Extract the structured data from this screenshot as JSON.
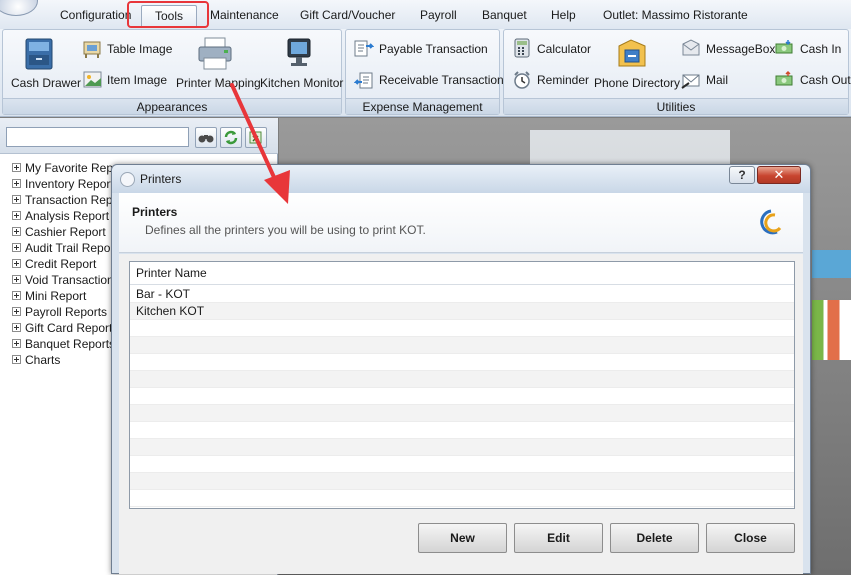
{
  "menu": {
    "items": [
      {
        "id": "configuration",
        "label": "Configuration"
      },
      {
        "id": "tools",
        "label": "Tools"
      },
      {
        "id": "maintenance",
        "label": "Maintenance"
      },
      {
        "id": "giftcard",
        "label": "Gift Card/Voucher"
      },
      {
        "id": "payroll",
        "label": "Payroll"
      },
      {
        "id": "banquet",
        "label": "Banquet"
      },
      {
        "id": "help",
        "label": "Help"
      },
      {
        "id": "outlet",
        "label": "Outlet: Massimo Ristorante"
      }
    ],
    "active": "Tools"
  },
  "ribbon": {
    "appearances": {
      "label": "Appearances",
      "cash_drawer": "Cash Drawer",
      "table_image": "Table Image",
      "item_image": "Item Image",
      "printer_mapping": "Printer Mapping",
      "kitchen_monitor": "Kitchen Monitor"
    },
    "expense": {
      "label": "Expense Management",
      "payable": "Payable Transaction",
      "receivable": "Receivable Transaction"
    },
    "utilities": {
      "label": "Utilities",
      "calculator": "Calculator",
      "reminder": "Reminder",
      "phone_directory": "Phone Directory",
      "messagebox": "MessageBox",
      "mail": "Mail",
      "cash_in": "Cash In",
      "cash_out": "Cash Out"
    }
  },
  "left_panel": {
    "search_value": "",
    "tree": [
      "My Favorite Reports",
      "Inventory Reports",
      "Transaction Reports",
      "Analysis Report",
      "Cashier Report",
      "Audit Trail Reports",
      "Credit Report",
      "Void Transaction",
      "Mini Report",
      "Payroll Reports",
      "Gift Card Reports",
      "Banquet Reports",
      "Charts"
    ]
  },
  "dialog": {
    "title": "Printers",
    "help_label": "?",
    "close_label": "✕",
    "header_title": "Printers",
    "header_desc": "Defines all the printers you will be using to print KOT.",
    "grid": {
      "column": "Printer Name",
      "rows": [
        "Bar - KOT",
        "Kitchen KOT"
      ]
    },
    "buttons": {
      "new": "New",
      "edit": "Edit",
      "delete": "Delete",
      "close": "Close"
    }
  },
  "colors": {
    "highlight": "#e8363a",
    "arrow": "#e8363a"
  }
}
